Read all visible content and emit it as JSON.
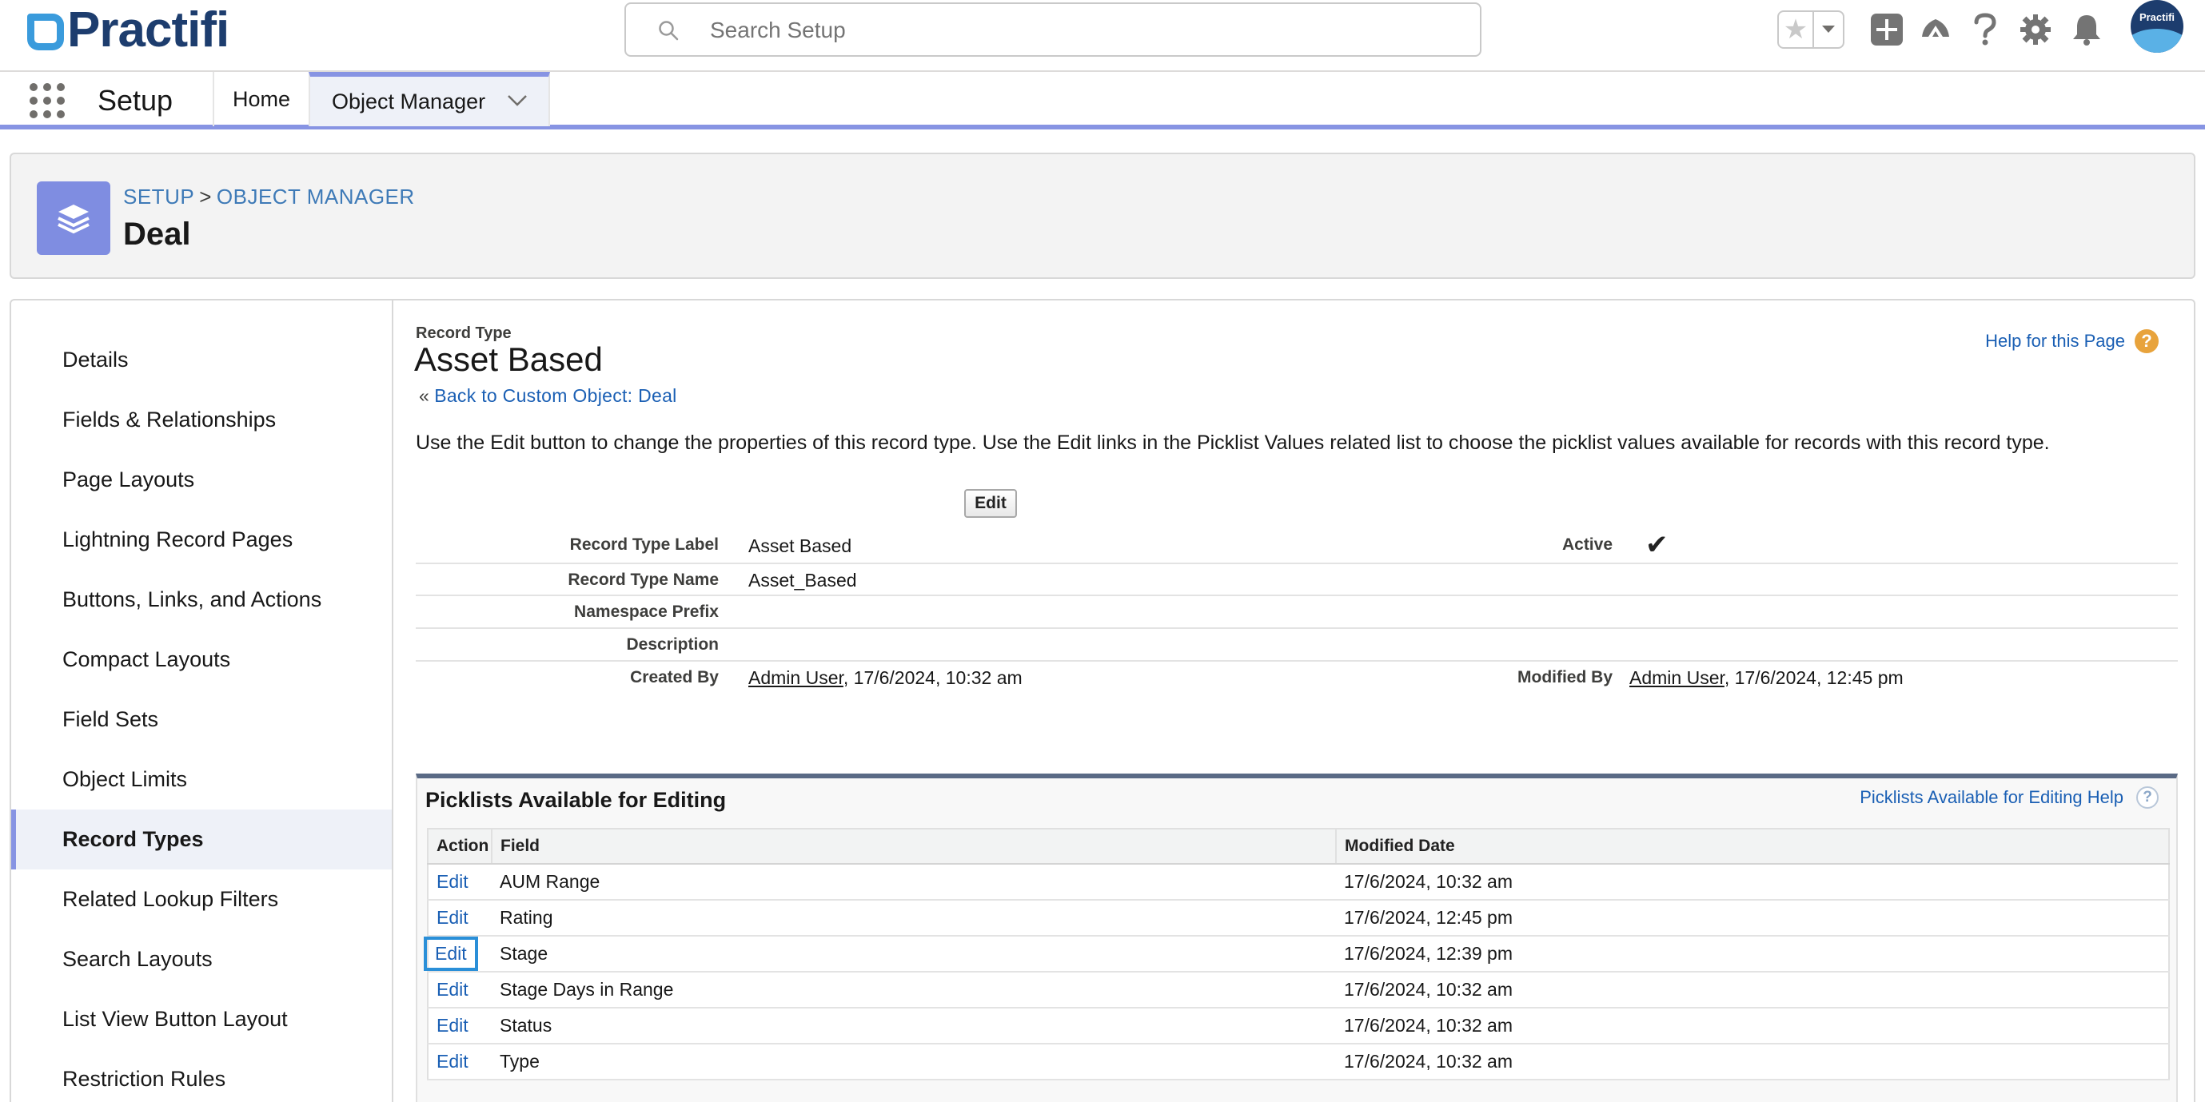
{
  "header": {
    "logo_text": "Practifi",
    "search_placeholder": "Search Setup",
    "avatar_text": "Practifi",
    "icons": [
      "star-icon",
      "chevron-down-icon",
      "add-icon",
      "trailhead-icon",
      "help-icon",
      "gear-icon",
      "bell-icon"
    ]
  },
  "nav": {
    "app_name": "Setup",
    "tabs": [
      {
        "label": "Home"
      },
      {
        "label": "Object Manager"
      }
    ]
  },
  "page_header": {
    "breadcrumb_setup": "SETUP",
    "breadcrumb_sep": ">",
    "breadcrumb_object_manager": "OBJECT MANAGER",
    "title": "Deal",
    "icon": "layers-icon"
  },
  "sidebar": {
    "items": [
      {
        "label": "Details"
      },
      {
        "label": "Fields & Relationships"
      },
      {
        "label": "Page Layouts"
      },
      {
        "label": "Lightning Record Pages"
      },
      {
        "label": "Buttons, Links, and Actions"
      },
      {
        "label": "Compact Layouts"
      },
      {
        "label": "Field Sets"
      },
      {
        "label": "Object Limits"
      },
      {
        "label": "Record Types"
      },
      {
        "label": "Related Lookup Filters"
      },
      {
        "label": "Search Layouts"
      },
      {
        "label": "List View Button Layout"
      },
      {
        "label": "Restriction Rules"
      }
    ],
    "active": "Record Types"
  },
  "content": {
    "section_label": "Record Type",
    "title": "Asset Based",
    "back_prefix": "«",
    "back_link": "Back to Custom Object: Deal",
    "help_link": "Help for this Page",
    "intro": "Use the Edit button to change the properties of this record type. Use the Edit links in the Picklist Values related list to choose the picklist values available for records with this record type.",
    "edit_button": "Edit",
    "details": {
      "record_type_label_label": "Record Type Label",
      "record_type_label_value": "Asset Based",
      "active_label": "Active",
      "active_value": "✔",
      "record_type_name_label": "Record Type Name",
      "record_type_name_value": "Asset_Based",
      "namespace_prefix_label": "Namespace Prefix",
      "description_label": "Description",
      "created_by_label": "Created By",
      "created_by_user": "Admin User",
      "created_by_date": ", 17/6/2024, 10:32 am",
      "modified_by_label": "Modified By",
      "modified_by_user": "Admin User",
      "modified_by_date": ", 17/6/2024, 12:45 pm"
    },
    "picklists": {
      "title": "Picklists Available for Editing",
      "help": "Picklists Available for Editing Help",
      "columns": [
        "Action",
        "Field",
        "Modified Date"
      ],
      "rows": [
        {
          "action": "Edit",
          "field": "AUM Range",
          "modified": "17/6/2024, 10:32 am"
        },
        {
          "action": "Edit",
          "field": "Rating",
          "modified": "17/6/2024, 12:45 pm"
        },
        {
          "action": "Edit",
          "field": "Stage",
          "modified": "17/6/2024, 12:39 pm"
        },
        {
          "action": "Edit",
          "field": "Stage Days in Range",
          "modified": "17/6/2024, 10:32 am"
        },
        {
          "action": "Edit",
          "field": "Status",
          "modified": "17/6/2024, 10:32 am"
        },
        {
          "action": "Edit",
          "field": "Type",
          "modified": "17/6/2024, 10:32 am"
        }
      ]
    }
  },
  "colors": {
    "brand_navy": "#1d3d6e",
    "accent": "#8794e3",
    "link": "#1a5fb4"
  }
}
